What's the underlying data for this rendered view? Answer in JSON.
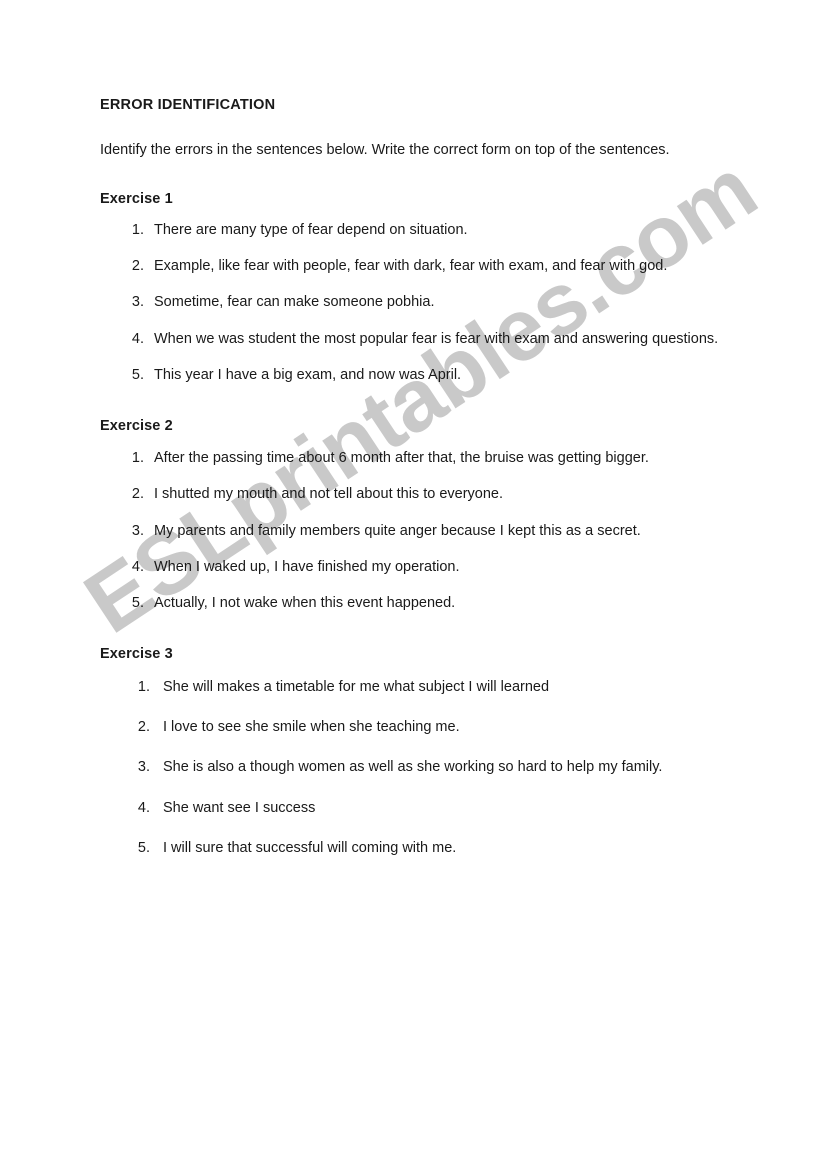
{
  "document": {
    "title": "ERROR IDENTIFICATION",
    "instructions": "Identify the errors in the sentences below. Write the correct form on top of the sentences.",
    "watermark": "ESLprintables.com",
    "watermark_color": "#c9c9c9",
    "text_color": "#1a1a1a",
    "background_color": "#ffffff",
    "exercises": [
      {
        "heading": "Exercise 1",
        "items": [
          "There are many type of fear depend on situation.",
          "Example, like fear with people, fear with dark, fear with exam, and fear with god.",
          "Sometime, fear can make someone pobhia.",
          "When we was student the most popular fear is fear with exam and answering questions.",
          "This year I have a big exam, and now was April."
        ]
      },
      {
        "heading": "Exercise 2",
        "items": [
          "After the passing time about 6 month after that, the bruise was getting bigger.",
          "I shutted my mouth and not tell about this to everyone.",
          "My parents and family members quite anger because I kept this as a secret.",
          "When I waked up, I have finished my operation.",
          "Actually, I not wake when this event happened."
        ]
      },
      {
        "heading": "Exercise 3",
        "items": [
          "She will makes a timetable for me what subject I will learned",
          "I love to see she smile when she teaching me.",
          "She is also a though women as well as she working so hard to help my family.",
          "She want see I success",
          "I will sure that successful will coming with me."
        ]
      }
    ]
  }
}
